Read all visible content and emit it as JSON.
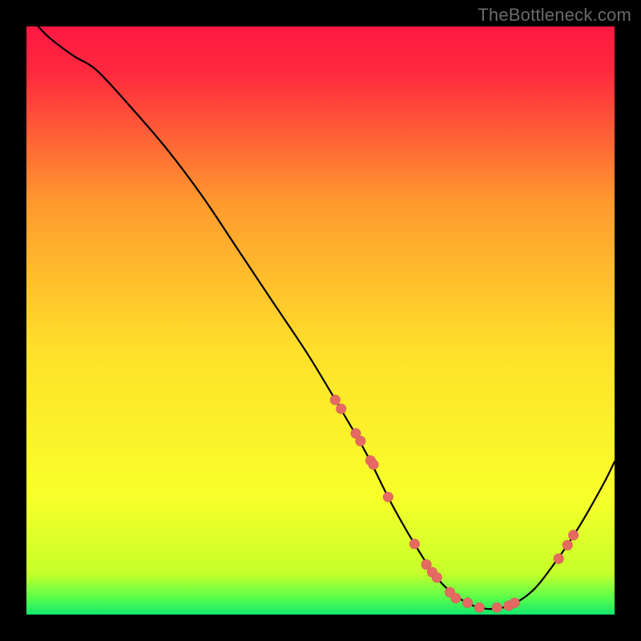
{
  "watermark": "TheBottleneck.com",
  "colors": {
    "background": "#000000",
    "curve": "#000000",
    "marker_fill": "#e66a62",
    "marker_stroke": "#cc5f58",
    "gradient_top": "#ff1842",
    "gradient_mid": "#ffd92a",
    "gradient_low": "#f7ff2a",
    "gradient_bottom": "#11e86c"
  },
  "chart_data": {
    "type": "line",
    "title": "",
    "xlabel": "",
    "ylabel": "",
    "xlim": [
      0,
      100
    ],
    "ylim": [
      0,
      100
    ],
    "series": [
      {
        "name": "curve",
        "x": [
          2,
          4,
          8,
          12,
          18,
          24,
          30,
          36,
          42,
          48,
          54,
          58,
          62,
          66,
          70,
          74,
          78,
          82,
          86,
          90,
          94,
          98,
          100
        ],
        "y": [
          100,
          98,
          95,
          92.5,
          86,
          79,
          71,
          62,
          53,
          44,
          34,
          27,
          19,
          12,
          6,
          2.5,
          1,
          1.5,
          4,
          9,
          15,
          22,
          26
        ]
      }
    ],
    "markers": {
      "name": "highlight-points",
      "x": [
        52.5,
        53.5,
        56.0,
        56.8,
        58.5,
        59.0,
        61.5,
        66.0,
        68.0,
        69.0,
        69.8,
        72.0,
        73.0,
        75.0,
        77.0,
        80.0,
        82.0,
        83.0,
        90.5,
        92.0,
        93.0
      ],
      "y": [
        36.5,
        35.0,
        30.8,
        29.5,
        26.2,
        25.5,
        20.0,
        12.0,
        8.5,
        7.2,
        6.3,
        3.8,
        2.8,
        2.0,
        1.2,
        1.2,
        1.5,
        2.0,
        9.5,
        11.8,
        13.5
      ]
    },
    "background_gradient": {
      "stops": [
        {
          "offset": 0.0,
          "color": "#ff1842"
        },
        {
          "offset": 0.08,
          "color": "#ff2a3e"
        },
        {
          "offset": 0.3,
          "color": "#ff9a2e"
        },
        {
          "offset": 0.55,
          "color": "#ffe02a"
        },
        {
          "offset": 0.8,
          "color": "#f8ff2a"
        },
        {
          "offset": 0.93,
          "color": "#c6ff2a"
        },
        {
          "offset": 0.97,
          "color": "#5eff4a"
        },
        {
          "offset": 1.0,
          "color": "#11e86c"
        }
      ]
    }
  }
}
